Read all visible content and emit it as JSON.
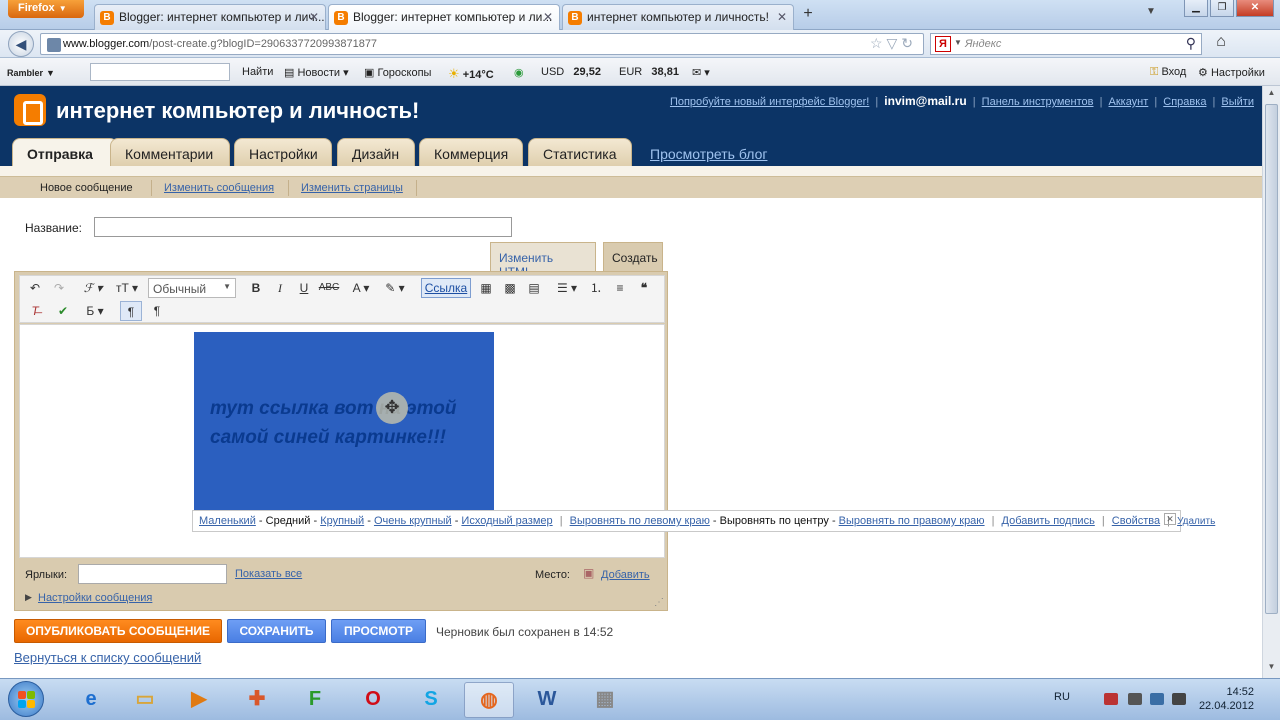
{
  "browser": {
    "app_button": "Firefox",
    "tabs": [
      {
        "label": "Blogger: интернет компьютер и лич..."
      },
      {
        "label": "Blogger: интернет компьютер и ли..."
      },
      {
        "label": "интернет компьютер и личность!"
      }
    ],
    "url_domain": "www.blogger.com",
    "url_path": "/post-create.g?blogID=2906337720993871877",
    "search_engine_placeholder": "Яндекс"
  },
  "rambler": {
    "logo": "Rambler",
    "find": "Найти",
    "news": "Новости",
    "horoscopes": "Гороскопы",
    "temperature": "+14°C",
    "usd_label": "USD",
    "usd_value": "29,52",
    "eur_label": "EUR",
    "eur_value": "38,81",
    "login": "Вход",
    "settings": "Настройки"
  },
  "blogger": {
    "blog_title": "интернет компьютер и личность!",
    "top_links": {
      "try_new": "Попробуйте новый интерфейс Blogger!",
      "email": "invim@mail.ru",
      "dashboard": "Панель инструментов",
      "account": "Аккаунт",
      "help": "Справка",
      "logout": "Выйти"
    },
    "main_tabs": [
      {
        "label": "Отправка"
      },
      {
        "label": "Комментарии"
      },
      {
        "label": "Настройки"
      },
      {
        "label": "Дизайн"
      },
      {
        "label": "Коммерция"
      },
      {
        "label": "Статистика"
      }
    ],
    "view_blog": "Просмотреть блог",
    "sub_tabs": [
      {
        "label": "Новое сообщение"
      },
      {
        "label": "Изменить сообщения"
      },
      {
        "label": "Изменить страницы"
      }
    ]
  },
  "post": {
    "title_label": "Название:",
    "title_value": "",
    "edit_html_tab": "Изменить HTML",
    "compose_tab": "Создать",
    "font_select": "Обычный",
    "link_button": "Ссылка",
    "image_text": "тут ссылка вот на этой самой синей картинке!!!",
    "image_toolbar": {
      "small": "Маленький",
      "medium": "Средний",
      "large": "Крупный",
      "xlarge": "Очень крупный",
      "original": "Исходный размер",
      "align_left": "Выровнять по левому краю",
      "align_center": "Выровнять по центру",
      "align_right": "Выровнять по правому краю",
      "add_caption": "Добавить подпись",
      "properties": "Свойства",
      "remove": "Удалить"
    },
    "labels_label": "Ярлыки:",
    "show_all": "Показать все",
    "location_label": "Место:",
    "add_location": "Добавить",
    "post_options": "Настройки сообщения",
    "publish_button": "ОПУБЛИКОВАТЬ СООБЩЕНИЕ",
    "save_button": "СОХРАНИТЬ",
    "preview_button": "ПРОСМОТР",
    "draft_status": "Черновик был сохранен в 14:52",
    "back_link": "Вернуться к списку сообщений"
  },
  "taskbar": {
    "language": "RU",
    "time": "14:52",
    "date": "22.04.2012"
  }
}
